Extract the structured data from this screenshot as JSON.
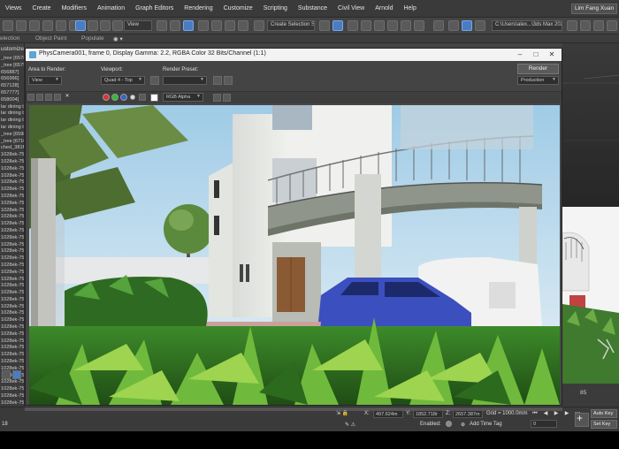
{
  "menu": [
    "Views",
    "Create",
    "Modifiers",
    "Animation",
    "Graph Editors",
    "Rendering",
    "Customize",
    "Scripting",
    "Substance",
    "Civil View",
    "Arnold",
    "Help"
  ],
  "user_name": "Lim Fang Xuan",
  "toolbar": {
    "view_combo": "View",
    "selection_set": "Create Selection Se",
    "path": "C:\\Users\\alex...\\3ds Max 202"
  },
  "ribbon": {
    "selection": "election",
    "object_paint": "Object Paint",
    "populate": "Populate"
  },
  "left_panel": {
    "header": "ustomize",
    "items": [
      "_tree [65785",
      "_tree [65790",
      "656887]",
      "656966]",
      "657128]",
      "657777]",
      "658004]",
      "lar dining tal",
      "lar dining tal",
      "lar dining tal",
      "lar dining tal",
      "_tree [659840",
      "_tree [671010",
      "ched_381fe",
      "1028ek-751",
      "1028ek-751",
      "1028ek-751",
      "1028ek-751",
      "1028ek-751",
      "1028ek-751",
      "1028ek-751",
      "1028ek-751",
      "1028ek-751",
      "1028ek-751",
      "1028ek-751",
      "1028ek-751",
      "1028ek-751",
      "1028ek-751",
      "1028ek-751",
      "1028ek-751",
      "1028ek-751",
      "1028ek-751",
      "1028ek-751",
      "1028ek-751",
      "1028ek-751",
      "1028ek-751",
      "1028ek-751",
      "1028ek-751",
      "1028ek-751",
      "1028ek-751",
      "1028ek-751",
      "1028ek-751",
      "1028ek-751",
      "1028ek-751",
      "1028ek-751",
      "1028ek-751",
      "1028ek-751",
      "1028ek-751",
      "1028ek-751",
      "1028ek-751",
      "1028ek-751"
    ]
  },
  "render_window": {
    "title": "PhysCamera001, frame 0, Display Gamma: 2.2, RGBA Color 32 Bits/Channel (1:1)",
    "area_label": "Area to Render:",
    "area_value": "View",
    "viewport_label": "Viewport:",
    "viewport_value": "Quad 4 - Top",
    "preset_label": "Render Preset:",
    "preset_value": "",
    "render_button": "Render",
    "production": "Production",
    "channel": "RGB Alpha"
  },
  "right_panel": {
    "frame_number": "85"
  },
  "status": {
    "x": "497.624m",
    "y": "1852.718r",
    "z": "2657.387m",
    "grid": "Grid = 1000.0mm",
    "enabled": "Enabled:",
    "add_time_tag": "Add Time Tag",
    "frame": "0",
    "auto_key": "Auto Key",
    "set_key": "Set Key",
    "frame_label": "18"
  },
  "colors": {
    "accent": "#4a7cc4",
    "titlebar": "#f3f3f3",
    "panel": "#3b3b3b"
  }
}
